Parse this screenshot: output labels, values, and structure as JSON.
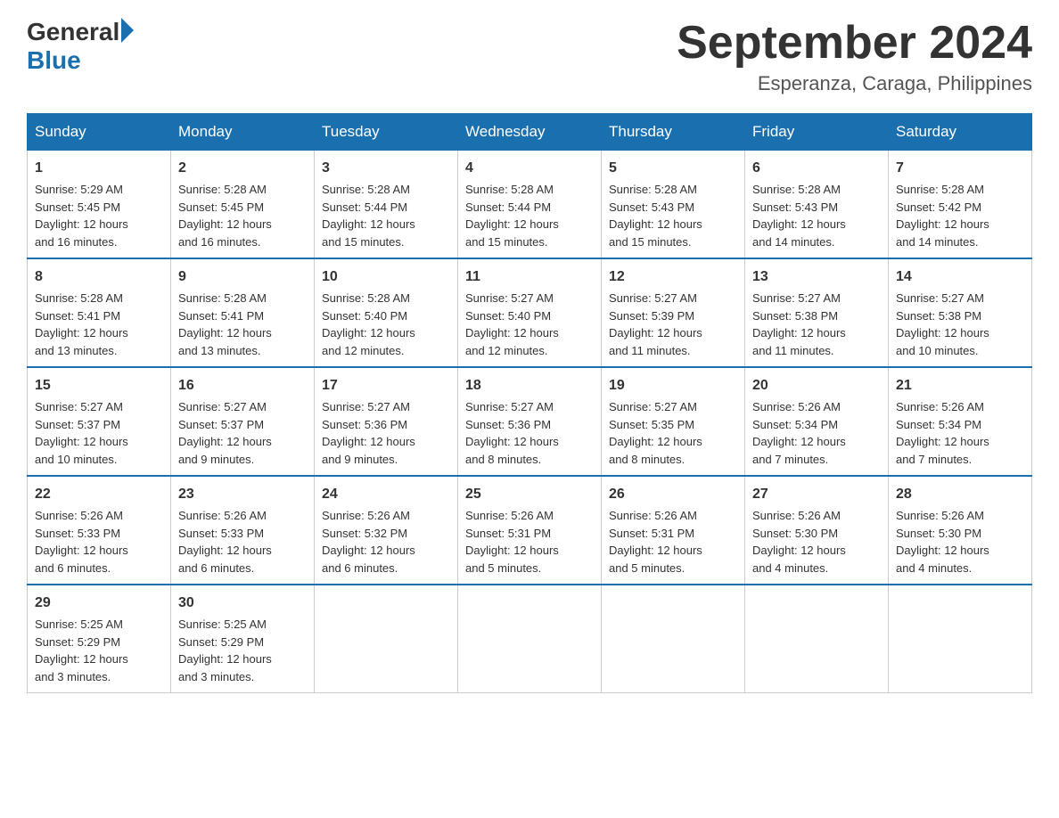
{
  "header": {
    "logo_general": "General",
    "logo_blue": "Blue",
    "month_title": "September 2024",
    "location": "Esperanza, Caraga, Philippines"
  },
  "weekdays": [
    "Sunday",
    "Monday",
    "Tuesday",
    "Wednesday",
    "Thursday",
    "Friday",
    "Saturday"
  ],
  "weeks": [
    [
      {
        "day": "1",
        "sunrise": "5:29 AM",
        "sunset": "5:45 PM",
        "daylight": "12 hours and 16 minutes."
      },
      {
        "day": "2",
        "sunrise": "5:28 AM",
        "sunset": "5:45 PM",
        "daylight": "12 hours and 16 minutes."
      },
      {
        "day": "3",
        "sunrise": "5:28 AM",
        "sunset": "5:44 PM",
        "daylight": "12 hours and 15 minutes."
      },
      {
        "day": "4",
        "sunrise": "5:28 AM",
        "sunset": "5:44 PM",
        "daylight": "12 hours and 15 minutes."
      },
      {
        "day": "5",
        "sunrise": "5:28 AM",
        "sunset": "5:43 PM",
        "daylight": "12 hours and 15 minutes."
      },
      {
        "day": "6",
        "sunrise": "5:28 AM",
        "sunset": "5:43 PM",
        "daylight": "12 hours and 14 minutes."
      },
      {
        "day": "7",
        "sunrise": "5:28 AM",
        "sunset": "5:42 PM",
        "daylight": "12 hours and 14 minutes."
      }
    ],
    [
      {
        "day": "8",
        "sunrise": "5:28 AM",
        "sunset": "5:41 PM",
        "daylight": "12 hours and 13 minutes."
      },
      {
        "day": "9",
        "sunrise": "5:28 AM",
        "sunset": "5:41 PM",
        "daylight": "12 hours and 13 minutes."
      },
      {
        "day": "10",
        "sunrise": "5:28 AM",
        "sunset": "5:40 PM",
        "daylight": "12 hours and 12 minutes."
      },
      {
        "day": "11",
        "sunrise": "5:27 AM",
        "sunset": "5:40 PM",
        "daylight": "12 hours and 12 minutes."
      },
      {
        "day": "12",
        "sunrise": "5:27 AM",
        "sunset": "5:39 PM",
        "daylight": "12 hours and 11 minutes."
      },
      {
        "day": "13",
        "sunrise": "5:27 AM",
        "sunset": "5:38 PM",
        "daylight": "12 hours and 11 minutes."
      },
      {
        "day": "14",
        "sunrise": "5:27 AM",
        "sunset": "5:38 PM",
        "daylight": "12 hours and 10 minutes."
      }
    ],
    [
      {
        "day": "15",
        "sunrise": "5:27 AM",
        "sunset": "5:37 PM",
        "daylight": "12 hours and 10 minutes."
      },
      {
        "day": "16",
        "sunrise": "5:27 AM",
        "sunset": "5:37 PM",
        "daylight": "12 hours and 9 minutes."
      },
      {
        "day": "17",
        "sunrise": "5:27 AM",
        "sunset": "5:36 PM",
        "daylight": "12 hours and 9 minutes."
      },
      {
        "day": "18",
        "sunrise": "5:27 AM",
        "sunset": "5:36 PM",
        "daylight": "12 hours and 8 minutes."
      },
      {
        "day": "19",
        "sunrise": "5:27 AM",
        "sunset": "5:35 PM",
        "daylight": "12 hours and 8 minutes."
      },
      {
        "day": "20",
        "sunrise": "5:26 AM",
        "sunset": "5:34 PM",
        "daylight": "12 hours and 7 minutes."
      },
      {
        "day": "21",
        "sunrise": "5:26 AM",
        "sunset": "5:34 PM",
        "daylight": "12 hours and 7 minutes."
      }
    ],
    [
      {
        "day": "22",
        "sunrise": "5:26 AM",
        "sunset": "5:33 PM",
        "daylight": "12 hours and 6 minutes."
      },
      {
        "day": "23",
        "sunrise": "5:26 AM",
        "sunset": "5:33 PM",
        "daylight": "12 hours and 6 minutes."
      },
      {
        "day": "24",
        "sunrise": "5:26 AM",
        "sunset": "5:32 PM",
        "daylight": "12 hours and 6 minutes."
      },
      {
        "day": "25",
        "sunrise": "5:26 AM",
        "sunset": "5:31 PM",
        "daylight": "12 hours and 5 minutes."
      },
      {
        "day": "26",
        "sunrise": "5:26 AM",
        "sunset": "5:31 PM",
        "daylight": "12 hours and 5 minutes."
      },
      {
        "day": "27",
        "sunrise": "5:26 AM",
        "sunset": "5:30 PM",
        "daylight": "12 hours and 4 minutes."
      },
      {
        "day": "28",
        "sunrise": "5:26 AM",
        "sunset": "5:30 PM",
        "daylight": "12 hours and 4 minutes."
      }
    ],
    [
      {
        "day": "29",
        "sunrise": "5:25 AM",
        "sunset": "5:29 PM",
        "daylight": "12 hours and 3 minutes."
      },
      {
        "day": "30",
        "sunrise": "5:25 AM",
        "sunset": "5:29 PM",
        "daylight": "12 hours and 3 minutes."
      },
      null,
      null,
      null,
      null,
      null
    ]
  ],
  "labels": {
    "sunrise": "Sunrise:",
    "sunset": "Sunset:",
    "daylight": "Daylight:"
  }
}
